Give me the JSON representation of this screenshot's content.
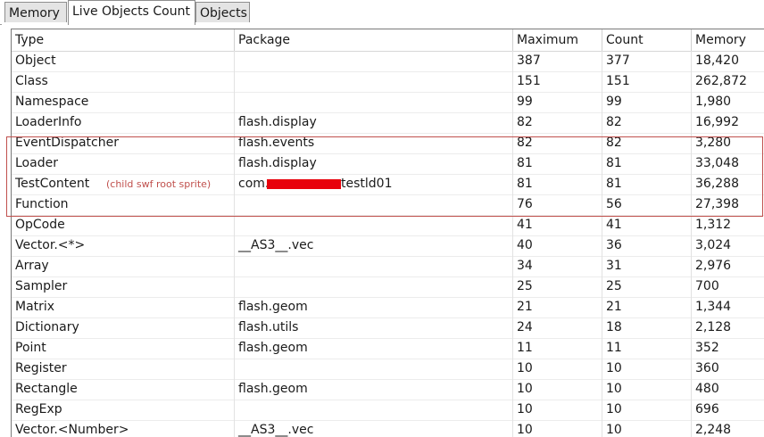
{
  "tabs": [
    {
      "label": "Memory",
      "active": false
    },
    {
      "label": "Live Objects Count",
      "active": true
    },
    {
      "label": "Objects",
      "active": false
    }
  ],
  "table": {
    "columns": [
      "Type",
      "Package",
      "Maximum",
      "Count",
      "Memory"
    ],
    "rows": [
      {
        "type": "Object",
        "package": "",
        "maximum": "387",
        "count": "377",
        "memory": "18,420"
      },
      {
        "type": "Class",
        "package": "",
        "maximum": "151",
        "count": "151",
        "memory": "262,872"
      },
      {
        "type": "Namespace",
        "package": "",
        "maximum": "99",
        "count": "99",
        "memory": "1,980"
      },
      {
        "type": "LoaderInfo",
        "package": "flash.display",
        "maximum": "82",
        "count": "82",
        "memory": "16,992"
      },
      {
        "type": "EventDispatcher",
        "package": "flash.events",
        "maximum": "82",
        "count": "82",
        "memory": "3,280"
      },
      {
        "type": "Loader",
        "package": "flash.display",
        "maximum": "81",
        "count": "81",
        "memory": "33,048"
      },
      {
        "type": "TestContent",
        "package": "",
        "package_prefix": "com.",
        "package_suffix": "testld01",
        "note": "(child swf root sprite)",
        "maximum": "81",
        "count": "81",
        "memory": "36,288"
      },
      {
        "type": "Function",
        "package": "",
        "maximum": "76",
        "count": "56",
        "memory": "27,398"
      },
      {
        "type": "OpCode",
        "package": "",
        "maximum": "41",
        "count": "41",
        "memory": "1,312"
      },
      {
        "type": "Vector.<*>",
        "package": "__AS3__.vec",
        "maximum": "40",
        "count": "36",
        "memory": "3,024"
      },
      {
        "type": "Array",
        "package": "",
        "maximum": "34",
        "count": "31",
        "memory": "2,976"
      },
      {
        "type": "Sampler",
        "package": "",
        "maximum": "25",
        "count": "25",
        "memory": "700"
      },
      {
        "type": "Matrix",
        "package": "flash.geom",
        "maximum": "21",
        "count": "21",
        "memory": "1,344"
      },
      {
        "type": "Dictionary",
        "package": "flash.utils",
        "maximum": "24",
        "count": "18",
        "memory": "2,128"
      },
      {
        "type": "Point",
        "package": "flash.geom",
        "maximum": "11",
        "count": "11",
        "memory": "352"
      },
      {
        "type": "Register",
        "package": "",
        "maximum": "10",
        "count": "10",
        "memory": "360"
      },
      {
        "type": "Rectangle",
        "package": "flash.geom",
        "maximum": "10",
        "count": "10",
        "memory": "480"
      },
      {
        "type": "RegExp",
        "package": "",
        "maximum": "10",
        "count": "10",
        "memory": "696"
      },
      {
        "type": "Vector.<Number>",
        "package": "__AS3__.vec",
        "maximum": "10",
        "count": "10",
        "memory": "2,248"
      }
    ]
  },
  "colors": {
    "highlight_border": "#c0504d",
    "redaction": "#e8000b"
  }
}
